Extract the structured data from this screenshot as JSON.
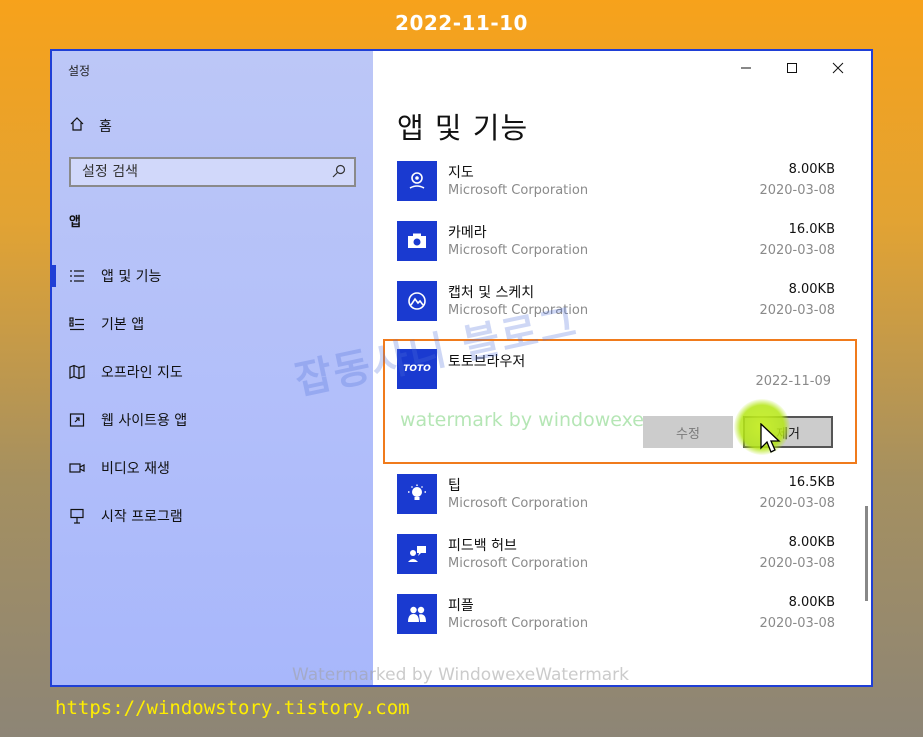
{
  "banner": {
    "date": "2022-11-10",
    "url": "https://windowstory.tistory.com"
  },
  "window": {
    "title": "설정"
  },
  "sidebar": {
    "home_label": "홈",
    "search_placeholder": "설정 검색",
    "section": "앱",
    "items": [
      {
        "label": "앱 및 기능",
        "icon": "list-icon",
        "active": true
      },
      {
        "label": "기본 앱",
        "icon": "default-apps-icon",
        "active": false
      },
      {
        "label": "오프라인 지도",
        "icon": "map-icon",
        "active": false
      },
      {
        "label": "웹 사이트용 앱",
        "icon": "website-app-icon",
        "active": false
      },
      {
        "label": "비디오 재생",
        "icon": "video-icon",
        "active": false
      },
      {
        "label": "시작 프로그램",
        "icon": "startup-icon",
        "active": false
      }
    ]
  },
  "main": {
    "title": "앱 및 기능",
    "apps": [
      {
        "name": "지도",
        "publisher": "Microsoft Corporation",
        "size": "8.00KB",
        "date": "2020-03-08",
        "icon": "maps-app-icon"
      },
      {
        "name": "카메라",
        "publisher": "Microsoft Corporation",
        "size": "16.0KB",
        "date": "2020-03-08",
        "icon": "camera-app-icon"
      },
      {
        "name": "캡처 및 스케치",
        "publisher": "Microsoft Corporation",
        "size": "8.00KB",
        "date": "2020-03-08",
        "icon": "snip-sketch-app-icon"
      },
      {
        "name": "토토브라우저",
        "publisher": "",
        "size": "",
        "date": "2022-11-09",
        "icon": "toto-app-icon",
        "icon_text": "TOTO",
        "selected": true
      },
      {
        "name": "팁",
        "publisher": "Microsoft Corporation",
        "size": "16.5KB",
        "date": "2020-03-08",
        "icon": "tips-app-icon"
      },
      {
        "name": "피드백 허브",
        "publisher": "Microsoft Corporation",
        "size": "8.00KB",
        "date": "2020-03-08",
        "icon": "feedback-hub-app-icon"
      },
      {
        "name": "피플",
        "publisher": "Microsoft Corporation",
        "size": "8.00KB",
        "date": "2020-03-08",
        "icon": "people-app-icon"
      }
    ],
    "modify_label": "수정",
    "uninstall_label": "제거"
  },
  "watermarks": {
    "blog": "잡동사니 블로그",
    "green": "watermark by windowexe",
    "bottom": "Watermarked by WindowexeWatermark"
  },
  "colors": {
    "accent": "#1f3fd6",
    "app_icon_bg": "#1a3ad0",
    "highlight": "#f07b1c",
    "banner_date": "#ffffff",
    "banner_url": "#ffee00"
  }
}
